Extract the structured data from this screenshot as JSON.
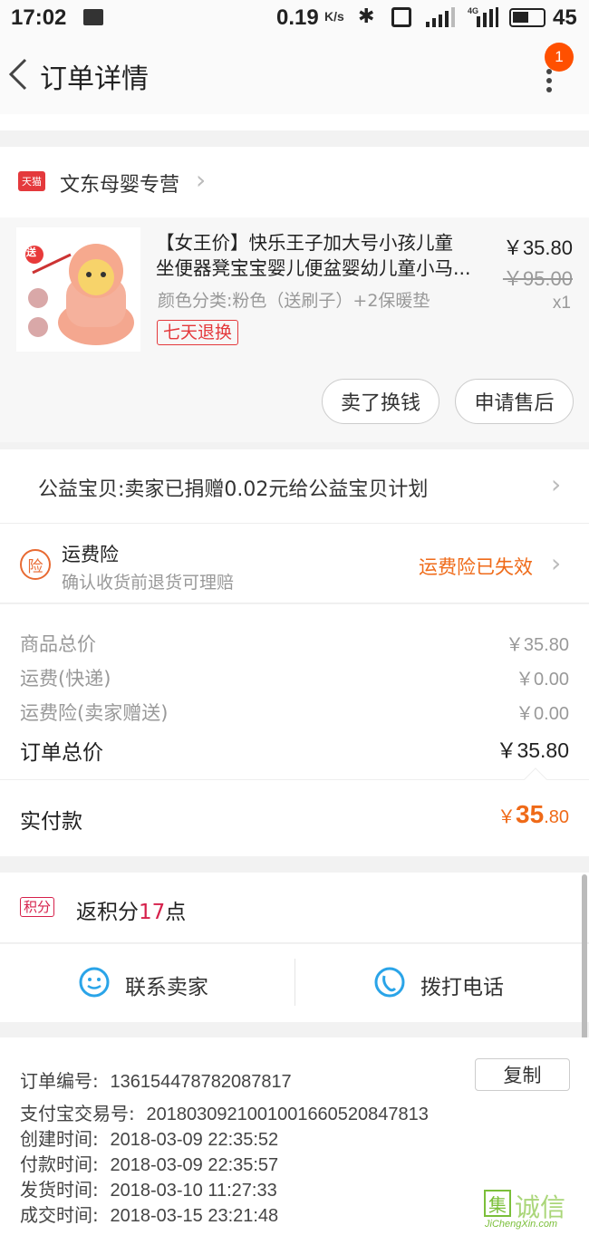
{
  "status_bar": {
    "time": "17:02",
    "speed": "0.19",
    "speed_unit": "K/s",
    "network": "4G",
    "battery": "45"
  },
  "header": {
    "title": "订单详情",
    "badge_count": "1"
  },
  "shop": {
    "badge": "天猫",
    "name": "文东母婴专营"
  },
  "product": {
    "title_line1": "【女王价】快乐王子加大号小孩儿童",
    "title_line2": "坐便器凳宝宝婴儿便盆婴幼儿童小马...",
    "variant": "颜色分类:粉色（送刷子）+2保暖垫",
    "tag": "七天退换",
    "promo": "送",
    "price": "￥35.80",
    "original_price": "￥95.00",
    "quantity": "x1"
  },
  "actions": {
    "sell_label": "卖了换钱",
    "after_sale_label": "申请售后"
  },
  "charity": {
    "text": "公益宝贝:卖家已捐赠0.02元给公益宝贝计划"
  },
  "insurance": {
    "icon_text": "险",
    "title": "运费险",
    "subtitle": "确认收货前退货可理赔",
    "status": "运费险已失效"
  },
  "pricing": {
    "items": [
      {
        "label": "商品总价",
        "value": "￥35.80"
      },
      {
        "label": "运费(快递)",
        "value": "￥0.00"
      },
      {
        "label": "运费险(卖家赠送)",
        "value": "￥0.00"
      }
    ],
    "total_label": "订单总价",
    "total_value": "￥35.80",
    "paid_label": "实付款",
    "paid_currency": "￥",
    "paid_int": "35",
    "paid_dec": ".80"
  },
  "points": {
    "badge": "积分",
    "prefix": "返积分",
    "amount": "17",
    "suffix": "点"
  },
  "contact": {
    "seller_label": "联系卖家",
    "phone_label": "拨打电话"
  },
  "order_info": {
    "order_no_label": "订单编号:",
    "order_no": "136154478782087817",
    "copy_label": "复制",
    "alipay_label": "支付宝交易号:",
    "alipay_no": "2018030921001001660520847813",
    "created_label": "创建时间:",
    "created": "2018-03-09 22:35:52",
    "paid_label": "付款时间:",
    "paid": "2018-03-09 22:35:57",
    "shipped_label": "发货时间:",
    "shipped": "2018-03-10 11:27:33",
    "done_label": "成交时间:",
    "done": "2018-03-15 23:21:48"
  },
  "watermark": {
    "char": "集",
    "text": "诚信",
    "domain": "JiChengXin.com"
  },
  "colors": {
    "accent_orange": "#ff5000",
    "tmall_red": "#e4393c",
    "points_red": "#d6204b",
    "contact_blue": "#2aa4e8"
  }
}
